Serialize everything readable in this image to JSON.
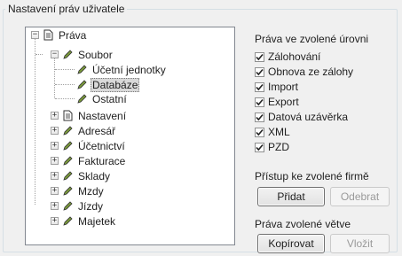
{
  "group": {
    "title": "Nastavení práv uživatele"
  },
  "tree": {
    "root": "Práva",
    "soubor": "Soubor",
    "soubor_children": [
      "Účetní jednotky",
      "Databáze",
      "Ostatní"
    ],
    "items": [
      "Nastavení",
      "Adresář",
      "Účetnictví",
      "Fakturace",
      "Sklady",
      "Mzdy",
      "Jízdy",
      "Majetek"
    ]
  },
  "rights": {
    "title": "Práva ve zvolené úrovni",
    "items": [
      {
        "label": "Zálohování",
        "checked": true
      },
      {
        "label": "Obnova ze zálohy",
        "checked": true
      },
      {
        "label": "Import",
        "checked": true
      },
      {
        "label": "Export",
        "checked": true
      },
      {
        "label": "Datová uzávěrka",
        "checked": true
      },
      {
        "label": "XML",
        "checked": true
      },
      {
        "label": "PZD",
        "checked": true
      }
    ]
  },
  "access": {
    "title": "Přístup ke zvolené firmě",
    "add": "Přidat",
    "remove": "Odebrat"
  },
  "branch": {
    "title": "Práva zvolené větve",
    "copy": "Kopírovat",
    "paste": "Vložit"
  },
  "colors": {
    "check": "#222222",
    "selection": "#d9d9d9"
  }
}
